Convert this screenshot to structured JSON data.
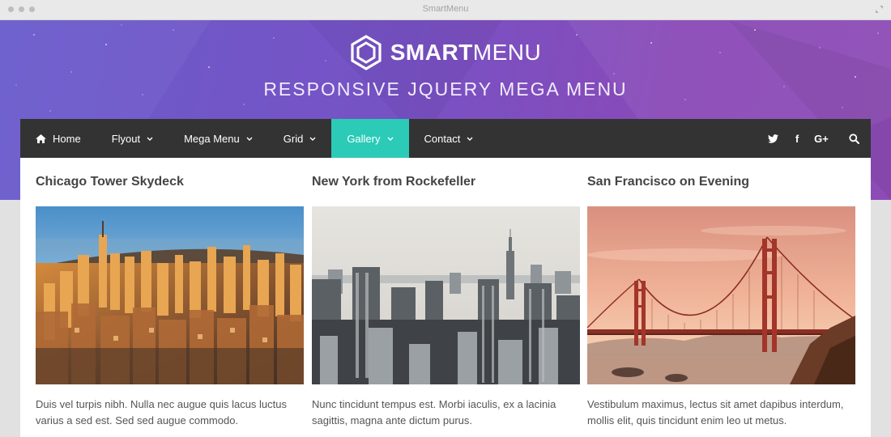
{
  "window": {
    "title": "SmartMenu"
  },
  "header": {
    "logo_bold": "SMART",
    "logo_light": "MENU",
    "tagline": "RESPONSIVE JQUERY MEGA MENU"
  },
  "nav": {
    "items": [
      {
        "label": "Home",
        "icon": "home-icon"
      },
      {
        "label": "Flyout",
        "dropdown": true
      },
      {
        "label": "Mega Menu",
        "dropdown": true
      },
      {
        "label": "Grid",
        "dropdown": true
      },
      {
        "label": "Gallery",
        "dropdown": true,
        "active": true
      },
      {
        "label": "Contact",
        "dropdown": true
      }
    ],
    "social": [
      {
        "name": "twitter-icon"
      },
      {
        "name": "facebook-icon",
        "glyph": "f"
      },
      {
        "name": "google-plus-icon",
        "glyph": "G+"
      }
    ],
    "search_icon": "search-icon",
    "active_color": "#2bcbb8",
    "bar_color": "#333333"
  },
  "gallery": [
    {
      "title": "Chicago Tower Skydeck",
      "description": "Duis vel turpis nibh. Nulla nec augue quis lacus luctus varius a sed est. Sed sed augue commodo."
    },
    {
      "title": "New York from Rockefeller",
      "description": "Nunc tincidunt tempus est. Morbi iaculis, ex a lacinia sagittis, magna ante dictum purus."
    },
    {
      "title": "San Francisco on Evening",
      "description": "Vestibulum maximus, lectus sit amet dapibus interdum, mollis elit, quis tincidunt enim leo ut metus."
    }
  ]
}
